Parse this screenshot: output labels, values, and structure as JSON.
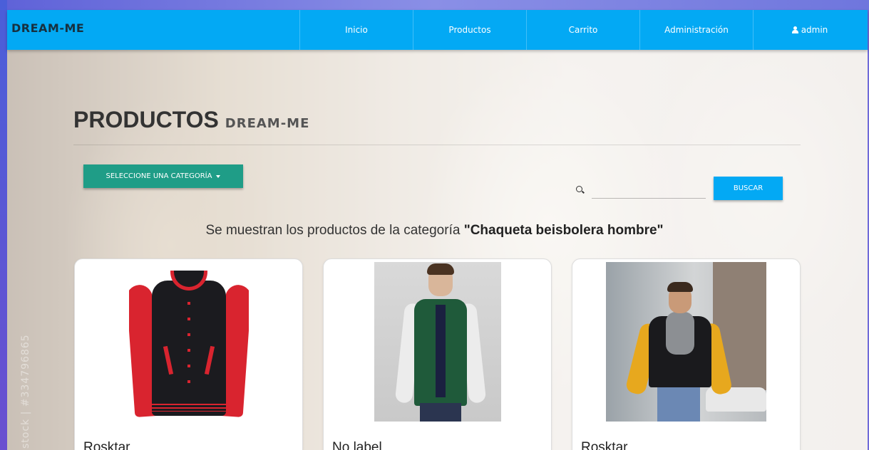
{
  "navbar": {
    "brand": "DREAM-ME",
    "items": [
      {
        "label": "Inicio"
      },
      {
        "label": "Productos"
      },
      {
        "label": "Carrito"
      },
      {
        "label": "Administración"
      },
      {
        "label": "admin",
        "icon": "user-icon"
      }
    ],
    "color": "#03a9f4"
  },
  "page": {
    "title": "PRODUCTOS",
    "subtitle": "DREAM-ME"
  },
  "filters": {
    "category_button": "SELECCIONE UNA CATEGORÍA",
    "search_icon": "search-icon",
    "search_placeholder": "",
    "search_button": "BUSCAR",
    "category_button_color": "#1f9d87"
  },
  "message": {
    "prefix": "Se muestran los productos de la categoría ",
    "category": "\"Chaqueta beisbolera hombre\""
  },
  "products": [
    {
      "name": "Rosktar"
    },
    {
      "name": "No label"
    },
    {
      "name": "Rosktar"
    }
  ],
  "watermark": "stock | #334796865"
}
